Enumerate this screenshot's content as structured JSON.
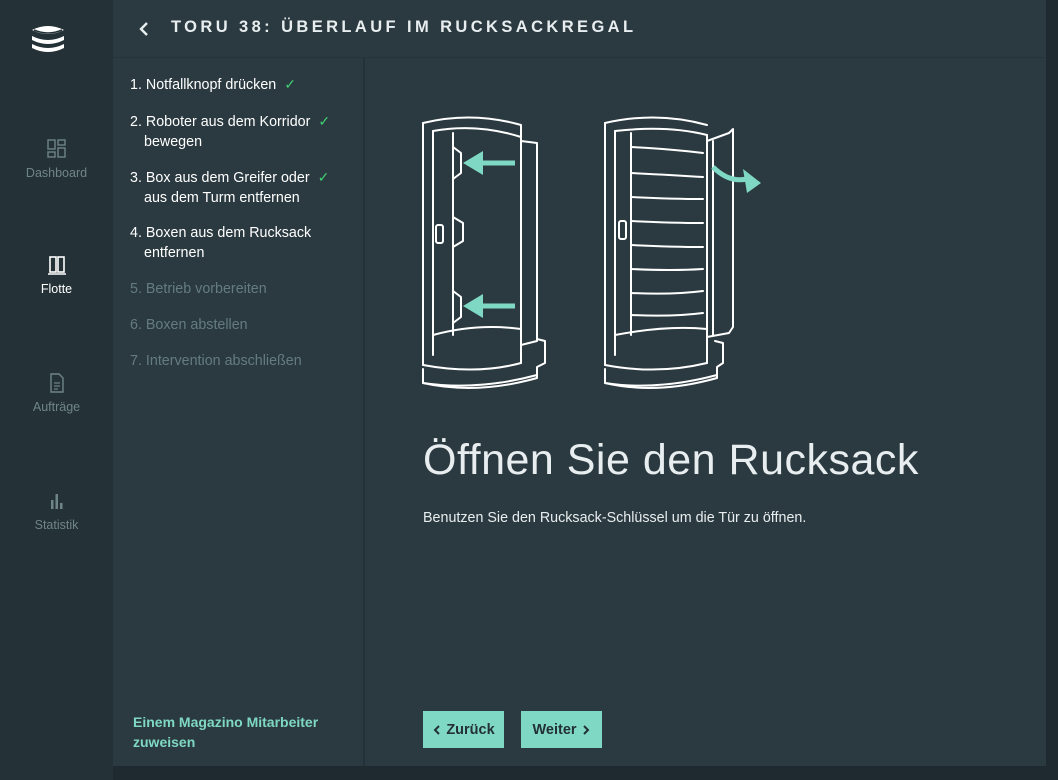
{
  "nav": {
    "items": [
      {
        "label": "Dashboard",
        "icon": "dashboard-icon",
        "active": false
      },
      {
        "label": "Flotte",
        "icon": "fleet-icon",
        "active": true
      },
      {
        "label": "Aufträge",
        "icon": "orders-icon",
        "active": false
      },
      {
        "label": "Statistik",
        "icon": "statistics-icon",
        "active": false
      }
    ]
  },
  "header": {
    "back_icon": "chevron-left-icon",
    "title": "TORU 38: ÜBERLAUF IM RUCKSACKREGAL"
  },
  "steps": [
    {
      "line1": "1. Notfallknopf drücken",
      "line2": "",
      "done": true
    },
    {
      "line1": "2. Roboter aus dem Korridor",
      "line2": "bewegen",
      "done": true
    },
    {
      "line1": "3. Box aus dem Greifer oder",
      "line2": "aus dem Turm entfernen",
      "done": true
    },
    {
      "line1": "4. Boxen aus dem Rucksack",
      "line2": "entfernen",
      "done": false,
      "current": true
    },
    {
      "line1": "5. Betrieb vorbereiten",
      "line2": "",
      "done": false
    },
    {
      "line1": "6. Boxen abstellen",
      "line2": "",
      "done": false
    },
    {
      "line1": "7. Intervention abschließen",
      "line2": "",
      "done": false
    }
  ],
  "check_glyph": "✓",
  "assign_link": "Einem Magazino Mitarbeiter zuweisen",
  "content": {
    "heading": "Öffnen Sie den Rucksack",
    "description": "Benutzen Sie den Rucksack-Schlüssel um die Tür zu öffnen.",
    "back_button": "Zurück",
    "next_button": "Weiter"
  },
  "colors": {
    "accent": "#7fd8c3",
    "check": "#3fcf72",
    "background": "#2b3a40",
    "nav_background": "#243238"
  }
}
